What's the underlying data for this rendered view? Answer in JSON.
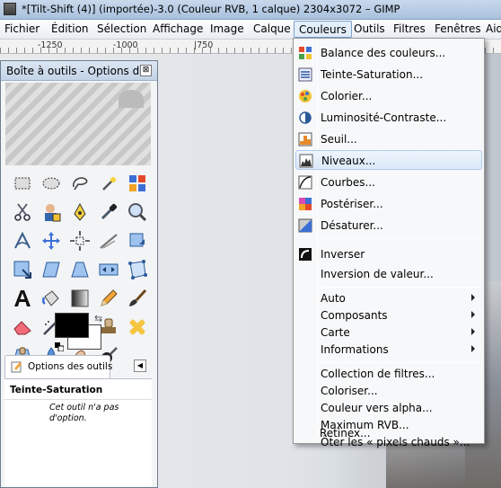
{
  "window": {
    "title": "*[Tilt-Shift (4)] (importée)-3.0 (Couleur RVB, 1 calque) 2304x3072 – GIMP"
  },
  "menubar": [
    "Fichier",
    "Édition",
    "Sélection",
    "Affichage",
    "Image",
    "Calque",
    "Couleurs",
    "Outils",
    "Filtres",
    "Fenêtres",
    "Aid"
  ],
  "ruler": {
    "labels": [
      "-1250",
      "-1000",
      "|750"
    ]
  },
  "toolbox": {
    "title": "Boîte à outils - Options d...",
    "close_label": "⊠",
    "tab_label": "Options des outils",
    "tab_arrow": "◀",
    "panel_heading": "Teinte-Saturation",
    "panel_message": "Cet outil n'a pas d'option.",
    "swap_glyph": "⇆"
  },
  "colors_menu": {
    "items": [
      {
        "label": "Balance des couleurs...",
        "icon": "color-balance-icon"
      },
      {
        "label": "Teinte-Saturation...",
        "icon": "hue-saturation-icon"
      },
      {
        "label": "Colorier...",
        "icon": "colorize-icon"
      },
      {
        "label": "Luminosité-Contraste...",
        "icon": "brightness-contrast-icon"
      },
      {
        "label": "Seuil...",
        "icon": "threshold-icon"
      },
      {
        "label": "Niveaux...",
        "icon": "levels-icon",
        "highlighted": true
      },
      {
        "label": "Courbes...",
        "icon": "curves-icon"
      },
      {
        "label": "Postériser...",
        "icon": "posterize-icon"
      },
      {
        "label": "Désaturer...",
        "icon": "desaturate-icon"
      },
      {
        "label": "Inverser",
        "icon": "invert-icon"
      },
      {
        "label": "Inversion de valeur..."
      },
      {
        "label": "Auto",
        "submenu": true
      },
      {
        "label": "Composants",
        "submenu": true
      },
      {
        "label": "Carte",
        "submenu": true
      },
      {
        "label": "Informations",
        "submenu": true
      },
      {
        "label": "Collection de filtres..."
      },
      {
        "label": "Coloriser..."
      },
      {
        "label": "Couleur vers alpha..."
      },
      {
        "label": "Maximum RVB..."
      },
      {
        "label": "Ôter les « pixels chauds »..."
      },
      {
        "label": "Retinex..."
      }
    ]
  },
  "colors": {
    "accent_highlight": "#dbe9f9",
    "title_bar": "#c3d3e7",
    "foreground": "#000000",
    "background": "#ffffff"
  }
}
